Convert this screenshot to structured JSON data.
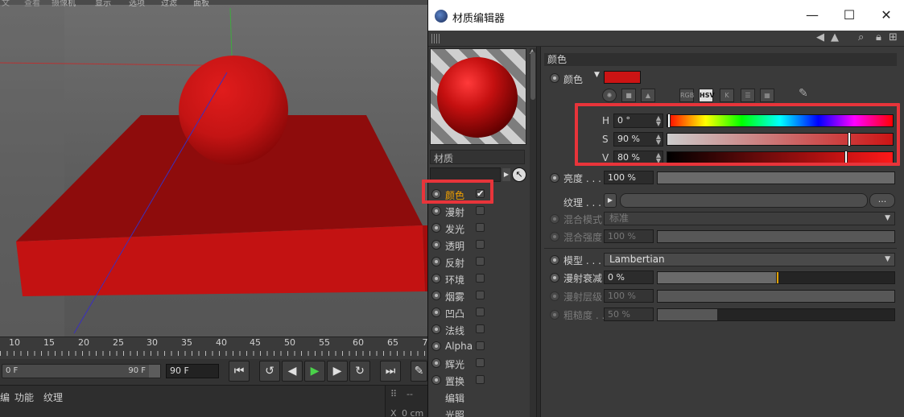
{
  "viewport": {
    "top_menu": [
      "文",
      "查看",
      "摄像机",
      "显示",
      "选项",
      "过滤",
      "面板"
    ]
  },
  "timeline": {
    "ticks": [
      "10",
      "15",
      "20",
      "25",
      "30",
      "35",
      "40",
      "45",
      "50",
      "55",
      "60",
      "65",
      "7"
    ],
    "range_start": "0 F",
    "range_end": "90 F",
    "current_frame": "90 F",
    "transport_icons": [
      "go-start-icon",
      "prev-key-icon",
      "step-back-icon",
      "play-icon",
      "step-forward-icon",
      "next-key-icon",
      "go-end-icon",
      "record-icon"
    ]
  },
  "bottom_menu": {
    "items": [
      "编",
      "功能",
      "纹理"
    ],
    "coord_label": "X",
    "coord_value": "0 cm",
    "coord_dash": "--"
  },
  "editor": {
    "title": "材质编辑器",
    "material_name": "材质",
    "channels": [
      {
        "label": "颜色",
        "enabled": true,
        "active": true
      },
      {
        "label": "漫射",
        "enabled": false
      },
      {
        "label": "发光",
        "enabled": false
      },
      {
        "label": "透明",
        "enabled": false
      },
      {
        "label": "反射",
        "enabled": false
      },
      {
        "label": "环境",
        "enabled": false
      },
      {
        "label": "烟雾",
        "enabled": false
      },
      {
        "label": "凹凸",
        "enabled": false
      },
      {
        "label": "法线",
        "enabled": false
      },
      {
        "label": "Alpha",
        "enabled": false
      },
      {
        "label": "辉光",
        "enabled": false
      },
      {
        "label": "置换",
        "enabled": false
      }
    ],
    "extra_items": [
      "编辑",
      "光照"
    ],
    "section_title": "颜色",
    "color_label": "颜色",
    "color_hex": "#cc1414",
    "mode_icons": [
      "RGB",
      "HSV",
      "K"
    ],
    "hsv": {
      "h_label": "H",
      "h_value": "0 °",
      "h_level": 0,
      "s_label": "S",
      "s_value": "90 %",
      "s_level": 0.9,
      "v_label": "V",
      "v_value": "80 %",
      "v_level": 0.8
    },
    "brightness_label": "亮度 . . .",
    "brightness_value": "100 %",
    "texture_label": "纹理 . . .",
    "texture_more": "...",
    "blend_mode_label": "混合模式",
    "blend_mode_value": "标准",
    "blend_strength_label": "混合强度",
    "blend_strength_value": "100 %",
    "model_label": "模型 . . .",
    "model_value": "Lambertian",
    "diffuse_falloff_label": "漫射衰减",
    "diffuse_falloff_value": "0 %",
    "diffuse_level_label": "漫射层级",
    "diffuse_level_value": "100 %",
    "roughness_label": "粗糙度 . .",
    "roughness_value": "50 %",
    "roughness_level": 0.5
  }
}
